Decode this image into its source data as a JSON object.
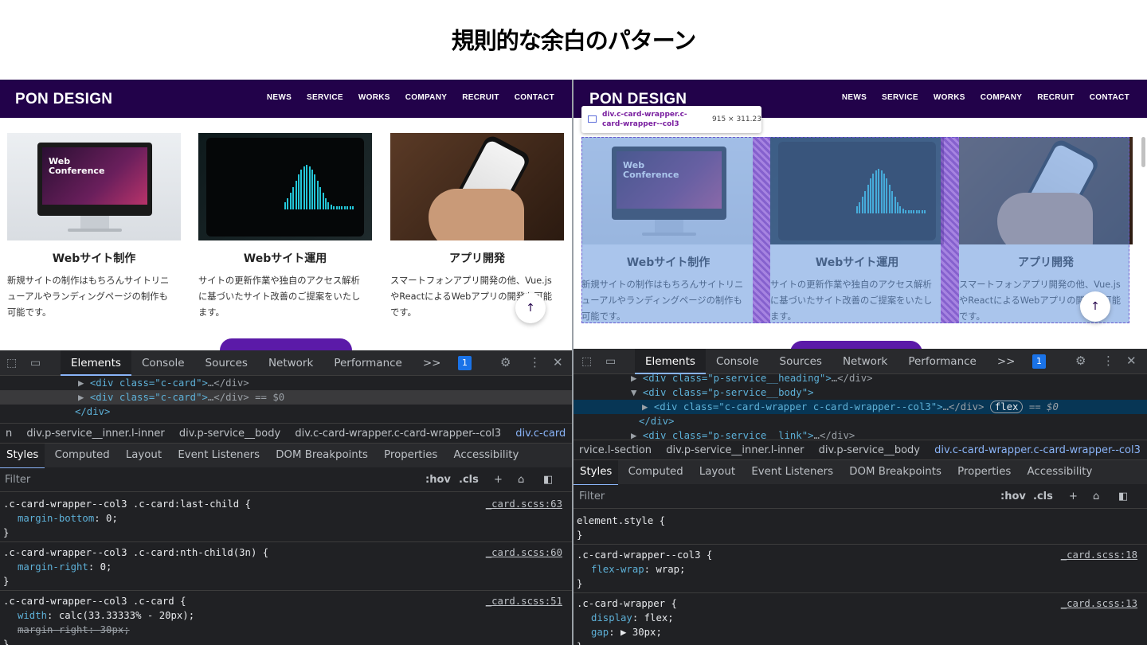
{
  "title": "規則的な余白のパターン",
  "site": {
    "logo": "PON DESIGN",
    "nav": [
      "NEWS",
      "SERVICE",
      "WORKS",
      "COMPANY",
      "RECRUIT",
      "CONTACT"
    ],
    "cards": [
      {
        "title": "Webサイト制作",
        "desc": "新規サイトの制作はもちろんサイトリニ\nューアルやランディングページの制作も\n可能です。",
        "screen_text": "Web\nConference"
      },
      {
        "title": "Webサイト運用",
        "desc": "サイトの更新作業や独自のアクセス解析\nに基づいたサイト改善のご提案をいたし\nます。"
      },
      {
        "title": "アプリ開発",
        "desc": "スマートフォンアプリ開発の他、Vue.js\nやReactによるWebアプリの開発も可能\nです。"
      }
    ]
  },
  "tooltip": {
    "name": "div.c-card-wrapper.c-card-wrapper--col3",
    "size": "915 × 311.23"
  },
  "devtools": {
    "tabs": [
      "Elements",
      "Console",
      "Sources",
      "Network",
      "Performance",
      ">>"
    ],
    "badge": "1",
    "left": {
      "code": [
        {
          "text": "<div class=\"c-card\">",
          "tail": "…</div>"
        },
        {
          "text": "<div class=\"c-card\">",
          "tail": "…</div> == $0"
        },
        {
          "text": "</div>"
        }
      ],
      "crumbs": [
        "n",
        "div.p-service__inner.l-inner",
        "div.p-service__body",
        "div.c-card-wrapper.c-card-wrapper--col3",
        "div.c-card"
      ],
      "subtabs": [
        "Styles",
        "Computed",
        "Layout",
        "Event Listeners",
        "DOM Breakpoints",
        "Properties",
        "Accessibility"
      ],
      "filter": "Filter",
      "hov": ":hov",
      ".cls": ".cls",
      "rules": [
        {
          "selector": ".c-card-wrapper--col3 .c-card:last-child {",
          "src": "_card.scss:63",
          "props": [
            [
              "margin-bottom",
              "0;"
            ]
          ]
        },
        {
          "selector": ".c-card-wrapper--col3 .c-card:nth-child(3n) {",
          "src": "_card.scss:60",
          "props": [
            [
              "margin-right",
              "0;"
            ]
          ]
        },
        {
          "selector": ".c-card-wrapper--col3 .c-card {",
          "src": "_card.scss:51",
          "props": [
            [
              "width",
              "calc(33.33333% - 20px);"
            ],
            [
              "margin-right",
              "30px;"
            ]
          ]
        }
      ]
    },
    "right": {
      "code": [
        {
          "text": "<div class=\"p-service__heading\">",
          "tail": "…</div>"
        },
        {
          "text": "<div class=\"p-service__body\">"
        },
        {
          "text": "<div class=\"c-card-wrapper c-card-wrapper--col3\">",
          "tail": "…</div>",
          "badge": "flex",
          "eq": "== $0"
        },
        {
          "text": "</div>"
        },
        {
          "text": "<div class=\"p-service__link\">",
          "tail": "…</div>"
        }
      ],
      "crumbs": [
        "rvice.l-section",
        "div.p-service__inner.l-inner",
        "div.p-service__body",
        "div.c-card-wrapper.c-card-wrapper--col3"
      ],
      "subtabs": [
        "Styles",
        "Computed",
        "Layout",
        "Event Listeners",
        "DOM Breakpoints",
        "Properties",
        "Accessibility"
      ],
      "filter": "Filter",
      "hov": ":hov",
      ".cls": ".cls",
      "rules": [
        {
          "selector": "element.style {",
          "src": "",
          "props": []
        },
        {
          "selector": ".c-card-wrapper--col3 {",
          "src": "_card.scss:18",
          "props": [
            [
              "flex-wrap",
              "wrap;"
            ]
          ]
        },
        {
          "selector": ".c-card-wrapper {",
          "src": "_card.scss:13",
          "props": [
            [
              "display",
              "flex;"
            ],
            [
              "gap",
              "▶ 30px;"
            ]
          ]
        }
      ]
    }
  },
  "colors": {
    "nav": "#22024a",
    "overlay": "#6496dc",
    "gap": "#966ee0",
    "devtools_bg": "#202124"
  }
}
